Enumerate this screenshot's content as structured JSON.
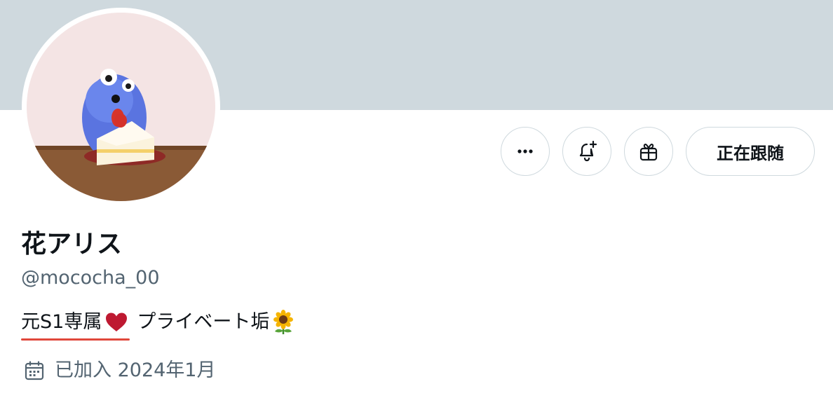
{
  "profile": {
    "display_name": "花アリス",
    "handle": "@mococha_00",
    "bio_marked": "元S1専属",
    "bio_rest": "プライベート垢",
    "joined": "已加入 2024年1月"
  },
  "actions": {
    "more_icon": "more-horizontal-icon",
    "notify_icon": "bell-plus-icon",
    "gift_icon": "gift-icon",
    "follow_label": "正在跟随"
  },
  "colors": {
    "banner": "#cfd9de",
    "secondary_text": "#536471",
    "underline": "#e0473b",
    "heart": "#be1931"
  }
}
